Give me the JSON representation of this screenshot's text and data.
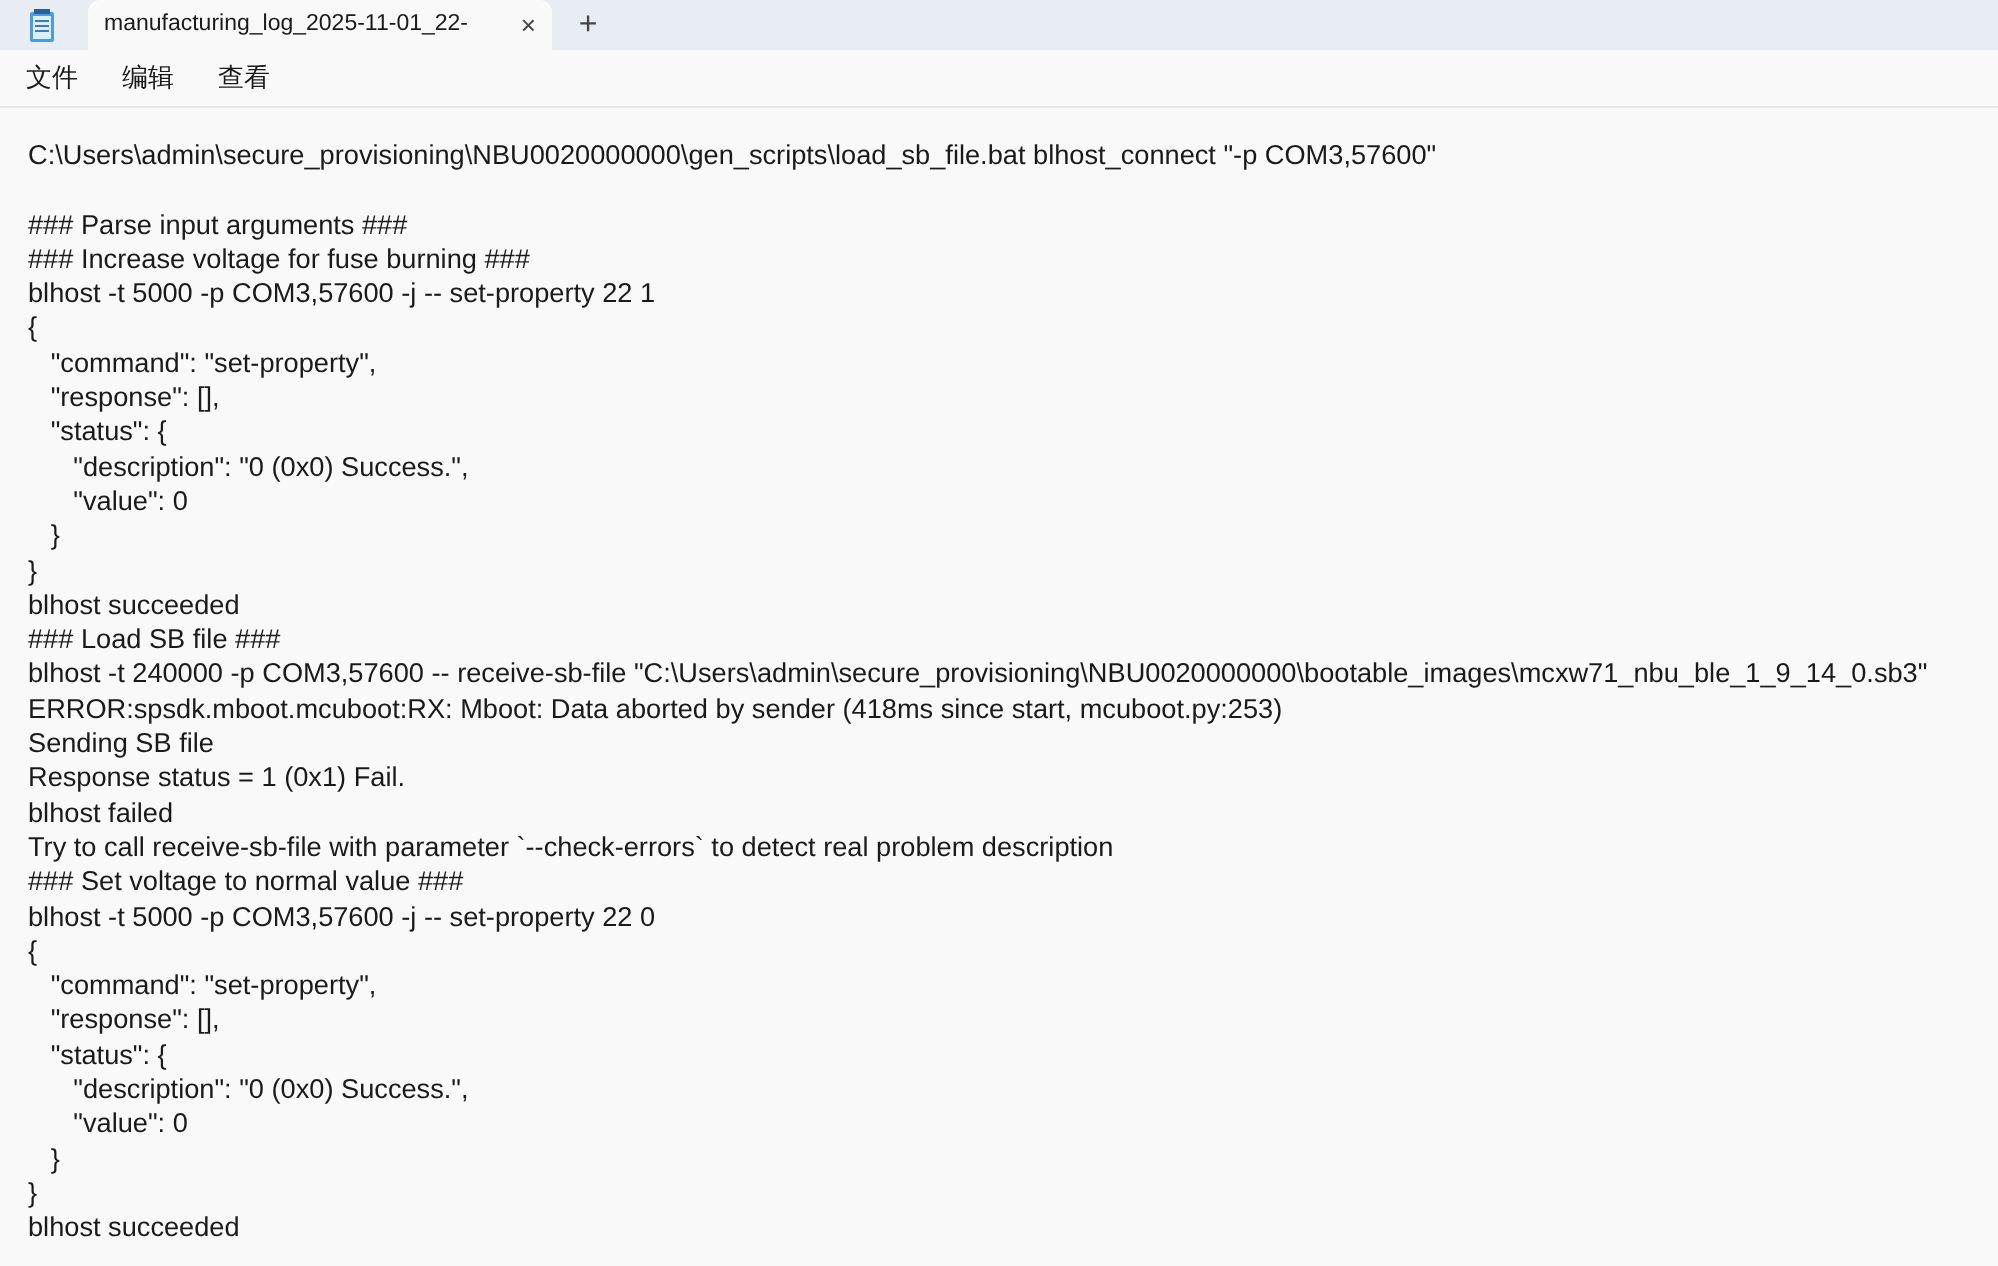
{
  "tabs": [
    {
      "title": "manufacturing_log_2025-11-01_22-",
      "close": "×",
      "selected": true
    }
  ],
  "new_tab": "+",
  "menu": [
    "文件",
    "编辑",
    "查看"
  ],
  "lines": [
    {
      "kind": "text",
      "text": "C:\\Users\\admin\\secure_provisioning\\NBU0020000000\\gen_scripts\\load_sb_file.bat blhost_connect \"-p COM3,57600\""
    },
    {
      "kind": "blank"
    },
    {
      "kind": "text",
      "text": "### Parse input arguments ###"
    },
    {
      "kind": "text",
      "text": "### Increase voltage for fuse burning ###"
    },
    {
      "kind": "text",
      "text": "blhost -t 5000 -p COM3,57600 -j -- set-property 22 1"
    },
    {
      "kind": "text",
      "text": "{"
    },
    {
      "kind": "text",
      "text": "   \"command\": \"set-property\","
    },
    {
      "kind": "text",
      "text": "   \"response\": [],"
    },
    {
      "kind": "text",
      "text": "   \"status\": {"
    },
    {
      "kind": "text",
      "text": "      \"description\": \"0 (0x0) Success.\","
    },
    {
      "kind": "text",
      "text": "      \"value\": 0"
    },
    {
      "kind": "text",
      "text": "   }"
    },
    {
      "kind": "text",
      "text": "}"
    },
    {
      "kind": "text",
      "text": "blhost succeeded"
    },
    {
      "kind": "text",
      "text": "### Load SB file ###"
    },
    {
      "kind": "text",
      "text": "blhost -t 240000 -p COM3,57600 -- receive-sb-file \"C:\\Users\\admin\\secure_provisioning\\NBU0020000000\\bootable_images\\mcxw71_nbu_ble_1_9_14_0.sb3\""
    },
    {
      "kind": "text",
      "text": "ERROR:spsdk.mboot.mcuboot:RX: Mboot: Data aborted by sender (418ms since start, mcuboot.py:253)"
    },
    {
      "kind": "text",
      "text": "Sending SB file"
    },
    {
      "kind": "text",
      "text": "Response status = 1 (0x1) Fail."
    },
    {
      "kind": "text",
      "text": "blhost failed"
    },
    {
      "kind": "text",
      "text": "Try to call receive-sb-file with parameter `--check-errors` to detect real problem description"
    },
    {
      "kind": "text",
      "text": "### Set voltage to normal value ###"
    },
    {
      "kind": "text",
      "text": "blhost -t 5000 -p COM3,57600 -j -- set-property 22 0"
    },
    {
      "kind": "text",
      "text": "{"
    },
    {
      "kind": "text",
      "text": "   \"command\": \"set-property\","
    },
    {
      "kind": "text",
      "text": "   \"response\": [],"
    },
    {
      "kind": "text",
      "text": "   \"status\": {"
    },
    {
      "kind": "text",
      "text": "      \"description\": \"0 (0x0) Success.\","
    },
    {
      "kind": "text",
      "text": "      \"value\": 0"
    },
    {
      "kind": "text",
      "text": "   }"
    },
    {
      "kind": "text",
      "text": "}"
    },
    {
      "kind": "text",
      "text": "blhost succeeded"
    }
  ]
}
